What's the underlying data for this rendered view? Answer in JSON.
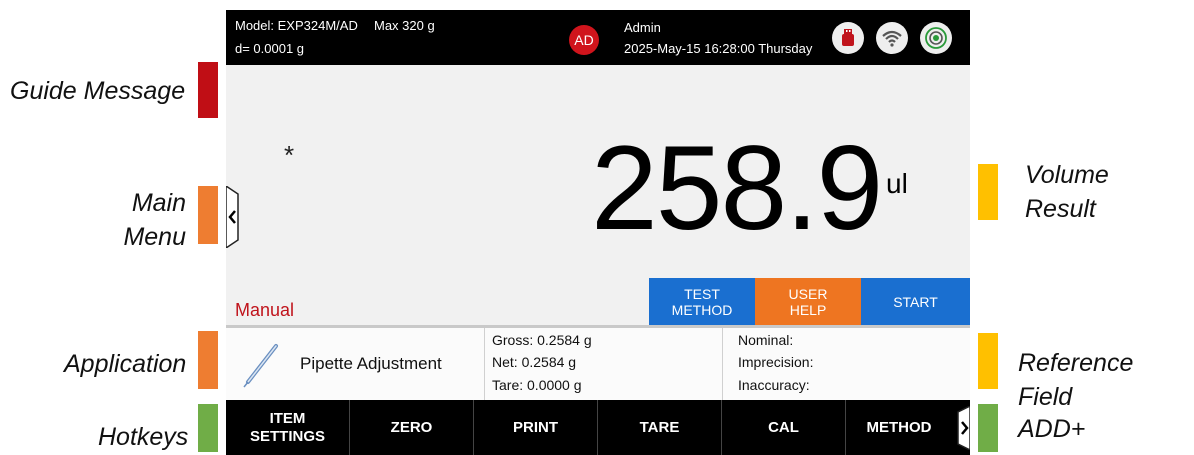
{
  "device": {
    "model": "Model: EXP324M/AD",
    "max": "Max 320 g",
    "readability": "d= 0.0001 g",
    "user_initials": "AD",
    "user_name": "Admin",
    "datetime": "2025-May-15 16:28:00 Thursday",
    "status_icons": [
      "usb-icon",
      "wifi-icon",
      "level-bubble-icon"
    ]
  },
  "display": {
    "asterisk": "*",
    "volume_value": "258.9",
    "volume_unit": "ul",
    "mode": "Manual"
  },
  "action_buttons": [
    {
      "label": "TEST\nMETHOD",
      "color": "#1a6fd0"
    },
    {
      "label": "USER\nHELP",
      "color": "#ee7521"
    },
    {
      "label": "START",
      "color": "#1a6fd0"
    }
  ],
  "application": {
    "icon": "pipette-icon",
    "name": "Pipette Adjustment"
  },
  "weights": {
    "gross": "Gross: 0.2584  g",
    "net": "Net: 0.2584  g",
    "tare": "Tare: 0.0000  g"
  },
  "reference": {
    "nominal": "Nominal:",
    "imprecision": "Imprecision:",
    "inaccuracy": "Inaccuracy:"
  },
  "hotkeys": [
    "ITEM\nSETTINGS",
    "ZERO",
    "PRINT",
    "TARE",
    "CAL",
    "METHOD"
  ],
  "callouts": {
    "guide_message": "Guide Message",
    "main_menu": "Main\nMenu",
    "application": "Application",
    "hotkeys": "Hotkeys",
    "volume_result": "Volume\nResult",
    "reference_field": "Reference Field",
    "add_plus": "ADD+"
  },
  "colors": {
    "red_marker": "#c00e15",
    "orange_marker": "#ee7d31",
    "yellow_marker": "#ffc000",
    "green_marker": "#70ad47",
    "brand_red": "#d0141c",
    "action_blue": "#1a6fd0",
    "action_orange": "#ee7521"
  }
}
